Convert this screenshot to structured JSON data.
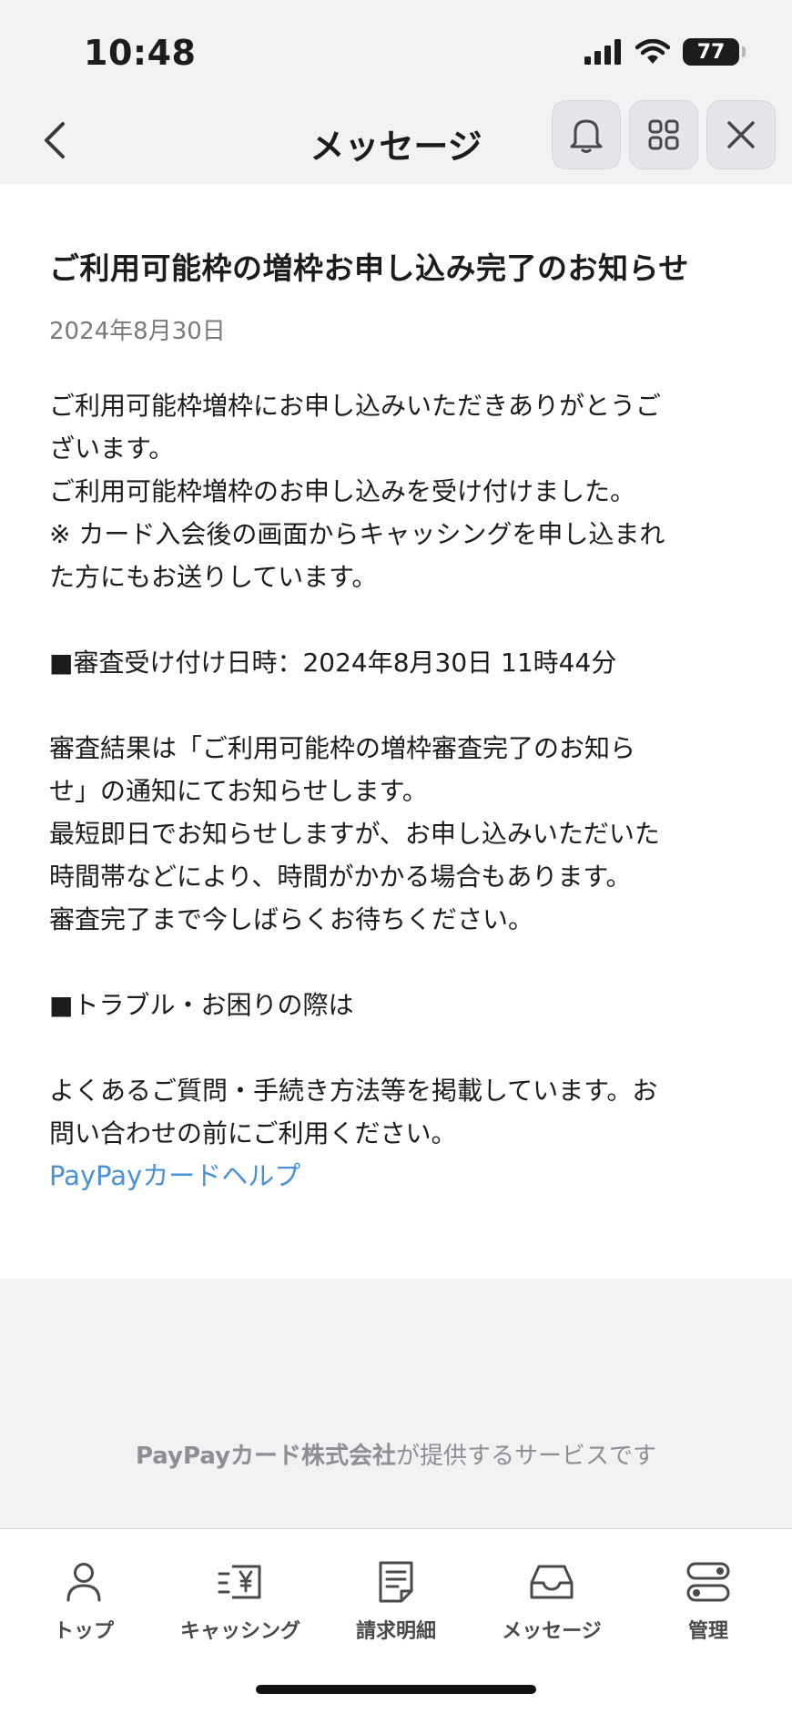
{
  "status_bar": {
    "time": "10:48",
    "battery": "77"
  },
  "header": {
    "title": "メッセージ"
  },
  "message": {
    "title": "ご利用可能枠の増枠お申し込み完了のお知らせ",
    "date": "2024年8月30日",
    "lines": [
      "ご利用可能枠増枠にお申し込みいただきありがとうご",
      "ざいます。",
      "ご利用可能枠増枠のお申し込みを受け付けました。",
      "※ カード入会後の画面からキャッシングを申し込まれ",
      "た方にもお送りしています。",
      "",
      "■審査受け付け日時：2024年8月30日 11時44分",
      "",
      "審査結果は「ご利用可能枠の増枠審査完了のお知ら",
      "せ」の通知にてお知らせします。",
      "最短即日でお知らせしますが、お申し込みいただいた",
      "時間帯などにより、時間がかかる場合もあります。",
      "審査完了まで今しばらくお待ちください。",
      "",
      "■トラブル・お困りの際は",
      "",
      "よくあるご質問・手続き方法等を掲載しています。お",
      "問い合わせの前にご利用ください。"
    ],
    "link_label": "PayPayカードヘルプ"
  },
  "footer": {
    "company": "PayPayカード株式会社",
    "suffix": "が提供するサービスです"
  },
  "tabs": [
    {
      "label": "トップ",
      "icon": "person-icon"
    },
    {
      "label": "キャッシング",
      "icon": "cash-yen-icon"
    },
    {
      "label": "請求明細",
      "icon": "statement-icon"
    },
    {
      "label": "メッセージ",
      "icon": "inbox-icon"
    },
    {
      "label": "管理",
      "icon": "toggles-icon"
    }
  ],
  "colors": {
    "link": "#4a90d9",
    "background": "#f2f2f4",
    "card": "#ffffff"
  }
}
